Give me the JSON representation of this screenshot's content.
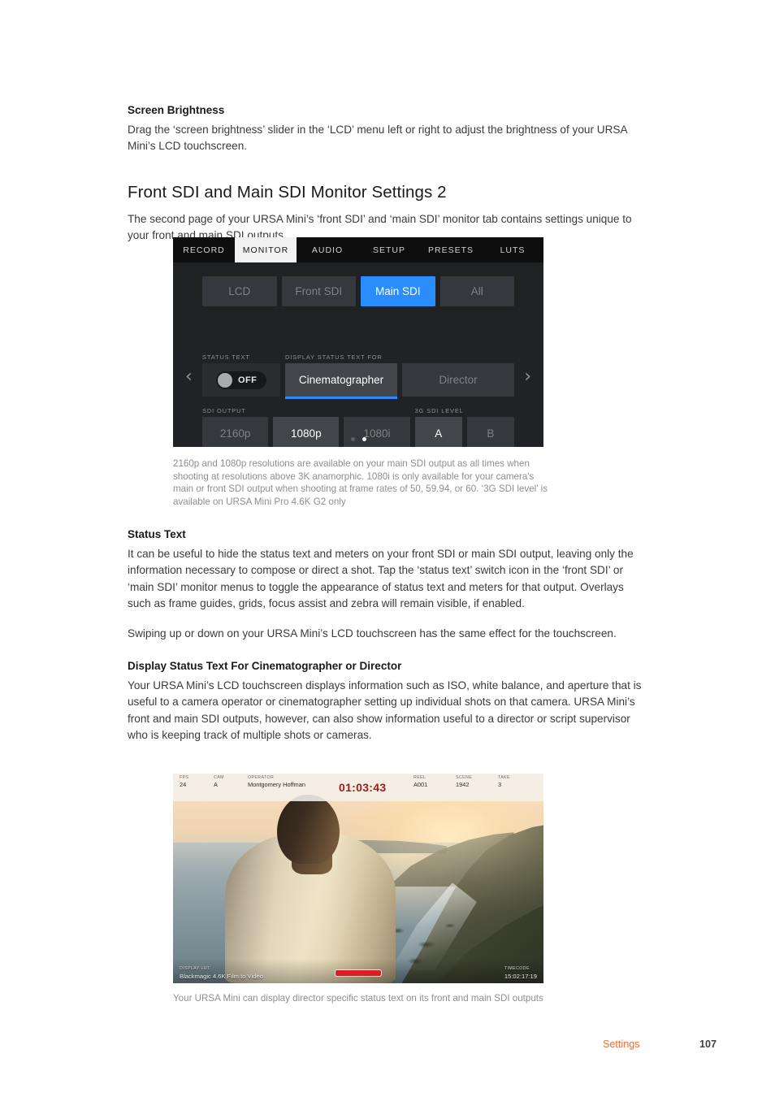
{
  "doc": {
    "screen_brightness": {
      "heading": "Screen Brightness",
      "paragraph": "Drag the ‘screen brightness’ slider in the ‘LCD’ menu left or right to adjust the brightness of your URSA Mini’s LCD touchscreen."
    },
    "sdi_settings": {
      "heading": "Front SDI and Main SDI Monitor Settings 2",
      "paragraph": "The second page of your URSA Mini’s ‘front SDI’ and ‘main SDI’ monitor tab contains settings unique to your front and main SDI outputs."
    },
    "figure1_caption": "2160p and 1080p resolutions are available on your main SDI output as all times when shooting at resolutions above 3K anamorphic. 1080i is only available for your camera's main or front SDI output when shooting at frame rates of 50, 59.94, or 60. ‘3G SDI level' is available on URSA Mini Pro 4.6K G2 only",
    "status_text": {
      "heading": "Status Text",
      "paragraph1": "It can be useful to hide the status text and meters on your front SDI or main SDI output, leaving only the information necessary to compose or direct a shot. Tap the ‘status text’ switch icon in the ‘front SDI’ or ‘main SDI’ monitor menus to toggle the appearance of status text and meters for that output. Overlays such as frame guides, grids, focus assist and zebra will remain visible, if enabled.",
      "paragraph2": "Swiping up or down on your URSA Mini’s LCD touchscreen has the same effect for the touchscreen."
    },
    "display_status": {
      "heading": "Display Status Text For Cinematographer or Director",
      "paragraph": "Your URSA Mini’s LCD touchscreen displays information such as ISO, white balance, and aperture that is useful to a camera operator or cinematographer setting up individual shots on that camera. URSA Mini’s front and main SDI outputs, however, can also show information useful to a director or script supervisor who is keeping track of multiple shots or cameras."
    },
    "figure2_caption": "Your URSA Mini can display director specific status text on its front and main SDI outputs",
    "footer": {
      "section": "Settings",
      "page": "107"
    }
  },
  "camera_ui": {
    "tabs": [
      {
        "label": "RECORD",
        "active": false
      },
      {
        "label": "MONITOR",
        "active": true
      },
      {
        "label": "AUDIO",
        "active": false
      },
      {
        "label": "SETUP",
        "active": false
      },
      {
        "label": "PRESETS",
        "active": false
      },
      {
        "label": "LUTS",
        "active": false
      }
    ],
    "outputs": [
      {
        "label": "LCD",
        "active": false
      },
      {
        "label": "Front SDI",
        "active": false
      },
      {
        "label": "Main SDI",
        "active": true
      },
      {
        "label": "All",
        "active": false
      }
    ],
    "status_text_group": {
      "label": "STATUS TEXT",
      "toggle_value": "OFF"
    },
    "display_status_group": {
      "label": "DISPLAY STATUS TEXT FOR",
      "options": [
        {
          "label": "Cinematographer",
          "selected": true
        },
        {
          "label": "Director",
          "selected": false
        }
      ]
    },
    "sdi_output_group": {
      "label": "SDI OUTPUT",
      "options": [
        {
          "label": "2160p",
          "selected": false
        },
        {
          "label": "1080p",
          "selected": true
        },
        {
          "label": "1080i",
          "selected": false
        }
      ]
    },
    "sdi_level_group": {
      "label": "3G SDI LEVEL",
      "options": [
        {
          "label": "A",
          "selected": true
        },
        {
          "label": "B",
          "selected": false
        }
      ]
    },
    "nav": {
      "prev": "‹",
      "next": "›"
    },
    "pagination": {
      "total": 2,
      "current": 2
    },
    "accent_color": "#2b8cfb"
  },
  "photo_overlay": {
    "top": {
      "fps": {
        "label": "FPS",
        "value": "24"
      },
      "cam": {
        "label": "CAM",
        "value": "A"
      },
      "operator": {
        "label": "OPERATOR",
        "value": "Montgomery Hoffman"
      },
      "timecode": "01:03:43",
      "reel": {
        "label": "REEL",
        "value": "A001"
      },
      "scene": {
        "label": "SCENE",
        "value": "1942"
      },
      "take": {
        "label": "TAKE",
        "value": "3"
      }
    },
    "bottom": {
      "display_lut": {
        "label": "DISPLAY LUT",
        "value": "Blackmagic 4.6K Film to Video"
      },
      "timecode": {
        "label": "TIMECODE",
        "value": "15:02:17:19"
      }
    },
    "record_color": "#d81f24",
    "timecode_color": "#9e1b1b"
  }
}
